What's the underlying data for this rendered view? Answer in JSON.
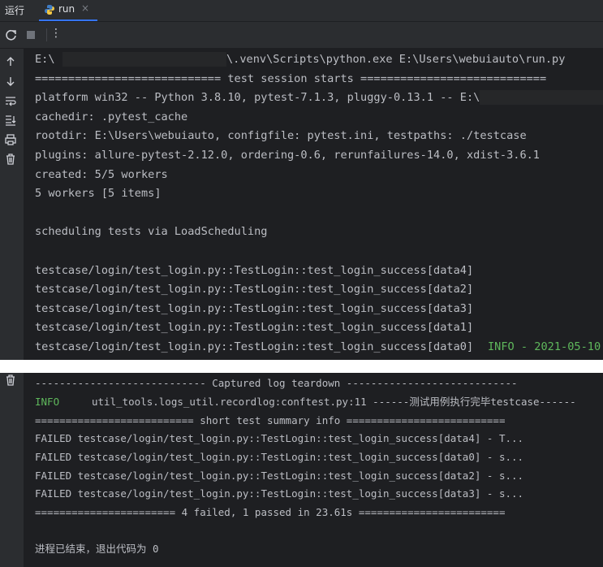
{
  "toolwindow": {
    "title": "运行",
    "tab_label": "run",
    "tab_close": "×"
  },
  "toolbar": {
    "more_label": "⋮"
  },
  "console_top": {
    "lines": [
      "E:\\",
      "\\.venv\\Scripts\\python.exe E:\\Users\\webuiauto\\run.py",
      "============================ test session starts ============================",
      "platform win32 -- Python 3.8.10, pytest-7.1.3, pluggy-0.13.1 -- E:\\",
      "cachedir: .pytest_cache",
      "rootdir: E:\\Users\\webuiauto, configfile: pytest.ini, testpaths: ./testcase",
      "plugins: allure-pytest-2.12.0, ordering-0.6, rerunfailures-14.0, xdist-3.6.1",
      "created: 5/5 workers",
      "5 workers [5 items]",
      "scheduling tests via LoadScheduling",
      "testcase/login/test_login.py::TestLogin::test_login_success[data4]",
      "testcase/login/test_login.py::TestLogin::test_login_success[data2]",
      "testcase/login/test_login.py::TestLogin::test_login_success[data3]",
      "testcase/login/test_login.py::TestLogin::test_login_success[data1]",
      "testcase/login/test_login.py::TestLogin::test_login_success[data0]"
    ],
    "info_text": "INFO - 2021-05-10"
  },
  "console_bottom": {
    "captured_header": "---------------------------- Captured log teardown ----------------------------",
    "log_level": "INFO",
    "log_message": "util_tools.logs_util.recordlog:conftest.py:11 ------测试用例执行完毕testcase------",
    "summary_header": "========================== short test summary info ==========================",
    "failed_lines": [
      "FAILED testcase/login/test_login.py::TestLogin::test_login_success[data4] - T...",
      "FAILED testcase/login/test_login.py::TestLogin::test_login_success[data0] - s...",
      "FAILED testcase/login/test_login.py::TestLogin::test_login_success[data2] - s...",
      "FAILED testcase/login/test_login.py::TestLogin::test_login_success[data3] - s..."
    ],
    "result_line": "======================= 4 failed, 1 passed in 23.61s ========================",
    "exit_line": "进程已结束，退出代码为 0"
  },
  "icons": {
    "tab": "python-icon",
    "toolbar": [
      "rerun-icon",
      "stop-icon",
      "more-icon"
    ],
    "gutter": [
      "arrow-up-icon",
      "arrow-down-icon",
      "soft-wrap-icon",
      "scroll-to-end-icon",
      "print-icon",
      "trash-icon"
    ]
  },
  "colors": {
    "background": "#1e1f22",
    "text": "#bcbec4",
    "info": "#5fb85c",
    "accent": "#3574f0"
  }
}
